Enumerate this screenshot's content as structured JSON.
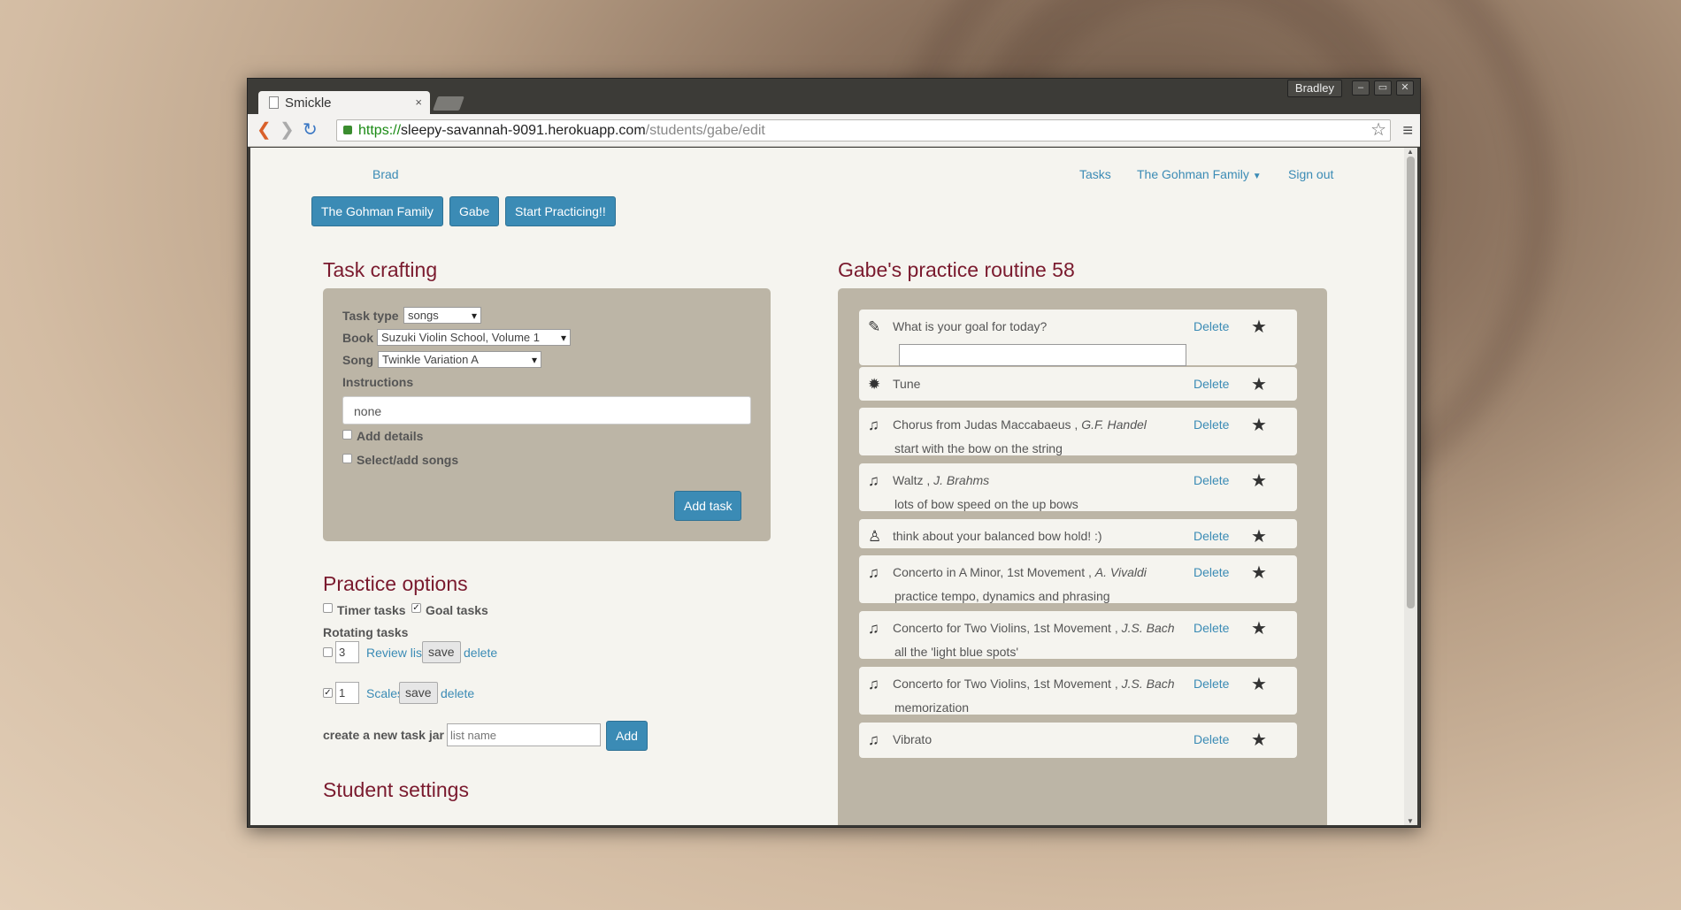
{
  "window": {
    "user": "Bradley",
    "tab_title": "Smickle",
    "tab_close": "×"
  },
  "browser": {
    "url_scheme": "https://",
    "url_host": "sleepy-savannah-9091.herokuapp.com",
    "url_path": "/students/gabe/edit"
  },
  "nav": {
    "brand": "Brad",
    "tasks": "Tasks",
    "family": "The Gohman Family",
    "signout": "Sign out"
  },
  "buttons": {
    "family": "The Gohman Family",
    "student": "Gabe",
    "start": "Start Practicing!!"
  },
  "crafting": {
    "title": "Task crafting",
    "task_type_label": "Task type",
    "task_type_value": "songs",
    "book_label": "Book",
    "book_value": "Suzuki Violin School, Volume 1",
    "song_label": "Song",
    "song_value": "Twinkle Variation A",
    "instructions_label": "Instructions",
    "instructions_value": "none",
    "add_details": "Add details",
    "select_songs": "Select/add songs",
    "add_task": "Add task"
  },
  "practice": {
    "title": "Practice options",
    "timer_tasks": "Timer tasks",
    "goal_tasks": "Goal tasks",
    "rotating": "Rotating tasks",
    "rows": [
      {
        "checked": false,
        "count": "3",
        "name": "Review list",
        "save": "save",
        "delete": "delete"
      },
      {
        "checked": true,
        "count": "1",
        "name": "Scales",
        "save": "save",
        "delete": "delete"
      }
    ],
    "jar_label": "create a new task jar",
    "jar_placeholder": "list name",
    "jar_add": "Add"
  },
  "settings": {
    "title": "Student settings"
  },
  "routine": {
    "title": "Gabe's practice routine 58",
    "delete": "Delete",
    "tasks": [
      {
        "icon": "pencil-icon",
        "glyph": "✎",
        "title": "What is your goal for today?",
        "composer": "",
        "sub": ""
      },
      {
        "icon": "gear-icon",
        "glyph": "✹",
        "title": "Tune",
        "composer": "",
        "sub": ""
      },
      {
        "icon": "music-icon",
        "glyph": "♫",
        "title": "Chorus from Judas Maccabaeus , ",
        "composer": "G.F. Handel",
        "sub": "start with the bow on the string"
      },
      {
        "icon": "music-icon",
        "glyph": "♫",
        "title": "Waltz , ",
        "composer": "J. Brahms",
        "sub": "lots of bow speed on the up bows"
      },
      {
        "icon": "person-icon",
        "glyph": "♙",
        "title": "think about your balanced bow hold! :)",
        "composer": "",
        "sub": ""
      },
      {
        "icon": "music-icon",
        "glyph": "♫",
        "title": "Concerto in A Minor, 1st Movement , ",
        "composer": "A. Vivaldi",
        "sub": "practice tempo, dynamics and phrasing"
      },
      {
        "icon": "music-icon",
        "glyph": "♫",
        "title": "Concerto for Two Violins, 1st Movement , ",
        "composer": "J.S. Bach",
        "sub": "all the 'light blue spots'"
      },
      {
        "icon": "music-icon",
        "glyph": "♫",
        "title": "Concerto for Two Violins, 1st Movement , ",
        "composer": "J.S. Bach",
        "sub": "memorization"
      },
      {
        "icon": "music-icon",
        "glyph": "♫",
        "title": "Vibrato",
        "composer": "",
        "sub": ""
      }
    ]
  }
}
